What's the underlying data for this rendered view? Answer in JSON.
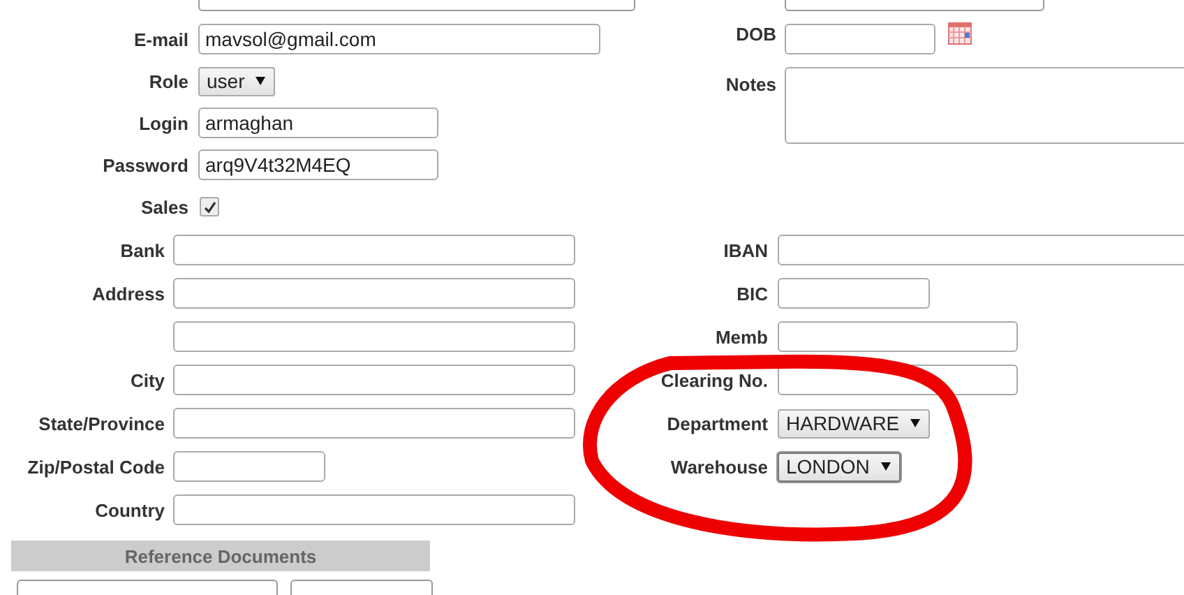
{
  "top_left": [
    {
      "label": "E-mail",
      "kind": "wide",
      "value": "mavsol@gmail.com"
    },
    {
      "label": "Role",
      "kind": "select",
      "value": "user"
    },
    {
      "label": "Login",
      "kind": "medium",
      "value": "armaghan"
    },
    {
      "label": "Password",
      "kind": "medium",
      "value": "arq9V4t32M4EQ"
    },
    {
      "label": "Sales",
      "kind": "checkbox",
      "checked": true
    }
  ],
  "top_right": [
    {
      "label": "DOB",
      "kind": "date"
    },
    {
      "label": "Notes",
      "kind": "textarea"
    }
  ],
  "bottom_left": [
    {
      "label": "Bank",
      "kind": "wide"
    },
    {
      "label": "Address",
      "kind": "wide"
    },
    {
      "kind": "wide"
    },
    {
      "label": "City",
      "kind": "wide"
    },
    {
      "label": "State/Province",
      "kind": "wide"
    },
    {
      "label": "Zip/Postal Code",
      "kind": "short"
    },
    {
      "label": "Country",
      "kind": "wide"
    }
  ],
  "bottom_right": [
    {
      "label": "IBAN",
      "kind": "full"
    },
    {
      "label": "BIC",
      "kind": "short"
    },
    {
      "label": "Memb",
      "kind": "medium"
    },
    {
      "label": "Clearing No.",
      "kind": "medium"
    },
    {
      "label": "Department",
      "kind": "select",
      "value": "HARDWARE"
    },
    {
      "label": "Warehouse",
      "kind": "select",
      "value": "LONDON",
      "focused": true
    }
  ],
  "section_header": {
    "title": "Reference Documents"
  },
  "annotation": {
    "kind": "circle",
    "color": "#ee0000"
  }
}
